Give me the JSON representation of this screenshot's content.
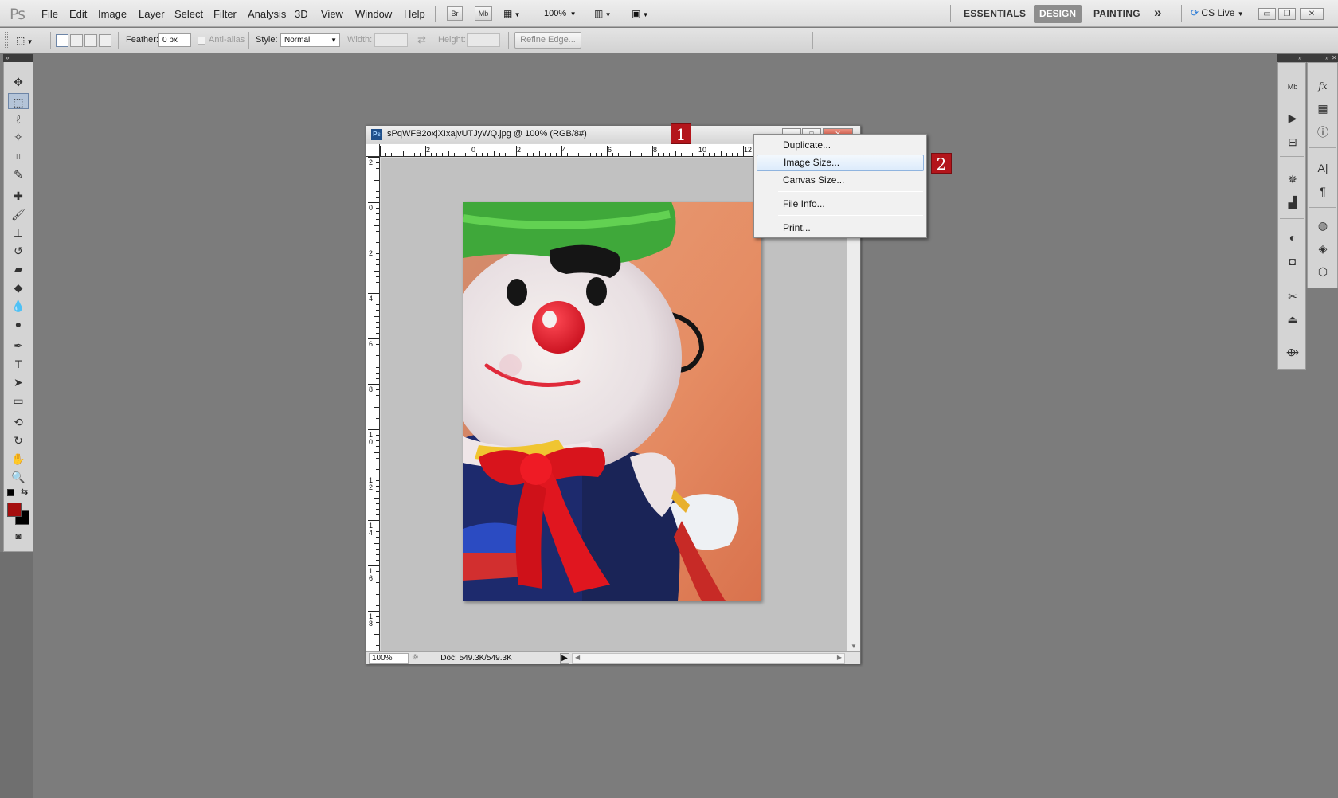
{
  "app": {
    "logo": "Ps",
    "menus": [
      "File",
      "Edit",
      "Image",
      "Layer",
      "Select",
      "Filter",
      "Analysis",
      "3D",
      "View",
      "Window",
      "Help"
    ],
    "bridge_label": "Br",
    "minibridge_label": "Mb",
    "zoom_select": "100%",
    "workspaces": {
      "essentials": "ESSENTIALS",
      "design": "DESIGN",
      "painting": "PAINTING",
      "more": "»"
    },
    "cslive": "CS Live"
  },
  "options_bar": {
    "feather_label": "Feather:",
    "feather_value": "0 px",
    "antialias_label": "Anti-alias",
    "style_label": "Style:",
    "style_value": "Normal",
    "width_label": "Width:",
    "height_label": "Height:",
    "refine_edge": "Refine Edge..."
  },
  "document": {
    "title": "sPqWFB2oxjXIxajvUTJyWQ.jpg @ 100% (RGB/8#)",
    "ps_icon": "Ps",
    "zoom": "100%",
    "doc_info": "Doc: 549.3K/549.3K",
    "hruler_labels": [
      "2",
      "0",
      "2",
      "4",
      "6",
      "8",
      "10",
      "12"
    ],
    "vruler_labels": [
      "2",
      "0",
      "2",
      "4",
      "6",
      "8",
      "10",
      "12",
      "14",
      "16",
      "18"
    ]
  },
  "context_menu": {
    "items": [
      "Duplicate...",
      "Image Size...",
      "Canvas Size...",
      "File Info...",
      "Print..."
    ],
    "highlighted": "Image Size..."
  },
  "badges": {
    "step1": "1",
    "step2": "2"
  },
  "colors": {
    "foreground": "#a50f0f",
    "background": "#000000",
    "accent_badge": "#b3151b"
  }
}
